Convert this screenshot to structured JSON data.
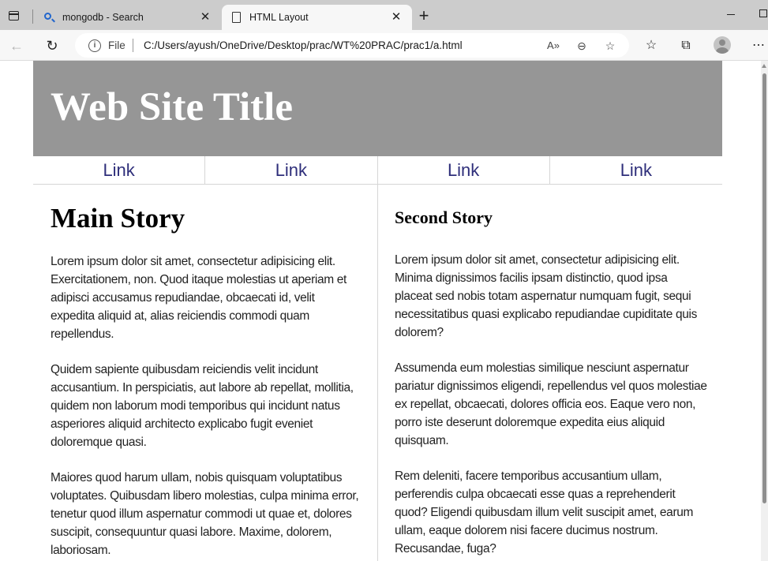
{
  "browser": {
    "tabs": [
      {
        "title": "mongodb - Search",
        "icon": "search-icon",
        "active": false
      },
      {
        "title": "HTML Layout",
        "icon": "page-icon",
        "active": true
      }
    ],
    "address": {
      "scheme_label": "File",
      "url": "C:/Users/ayush/OneDrive/Desktop/prac/WT%20PRAC/prac1/a.html"
    }
  },
  "page": {
    "site_title": "Web Site Title",
    "nav": [
      "Link",
      "Link",
      "Link",
      "Link"
    ],
    "main_story": {
      "heading": "Main Story",
      "paragraphs": [
        "Lorem ipsum dolor sit amet, consectetur adipisicing elit. Exercitationem, non. Quod itaque molestias ut aperiam et adipisci accusamus repudiandae, obcaecati id, velit expedita aliquid at, alias reiciendis commodi quam repellendus.",
        "Quidem sapiente quibusdam reiciendis velit incidunt accusantium. In perspiciatis, aut labore ab repellat, mollitia, quidem non laborum modi temporibus qui incidunt natus asperiores aliquid architecto explicabo fugit eveniet doloremque quasi.",
        "Maiores quod harum ullam, nobis quisquam voluptatibus voluptates. Quibusdam libero molestias, culpa minima error, tenetur quod illum aspernatur commodi ut quae et, dolores suscipit, consequuntur quasi labore. Maxime, dolorem, laboriosam."
      ]
    },
    "second_story": {
      "heading": "Second Story",
      "paragraphs": [
        "Lorem ipsum dolor sit amet, consectetur adipisicing elit. Minima dignissimos facilis ipsam distinctio, quod ipsa placeat sed nobis totam aspernatur numquam fugit, sequi necessitatibus quasi explicabo repudiandae cupiditate quis dolorem?",
        "Assumenda eum molestias similique nesciunt aspernatur pariatur dignissimos eligendi, repellendus vel quos molestiae ex repellat, obcaecati, dolores officia eos. Eaque vero non, porro iste deserunt doloremque expedita eius aliquid quisquam.",
        "Rem deleniti, facere temporibus accusantium ullam, perferendis culpa obcaecati esse quas a reprehenderit quod? Eligendi quibusdam illum velit suscipit amet, earum ullam, eaque dolorem nisi facere ducimus nostrum. Recusandae, fuga?"
      ]
    }
  },
  "colors": {
    "header_bg": "#969696",
    "title_text": "#ffffff",
    "nav_link": "#2e2e7a",
    "divider": "#d6d6d6",
    "tab_strip": "#cccccc",
    "toolbar": "#f7f7f7"
  }
}
